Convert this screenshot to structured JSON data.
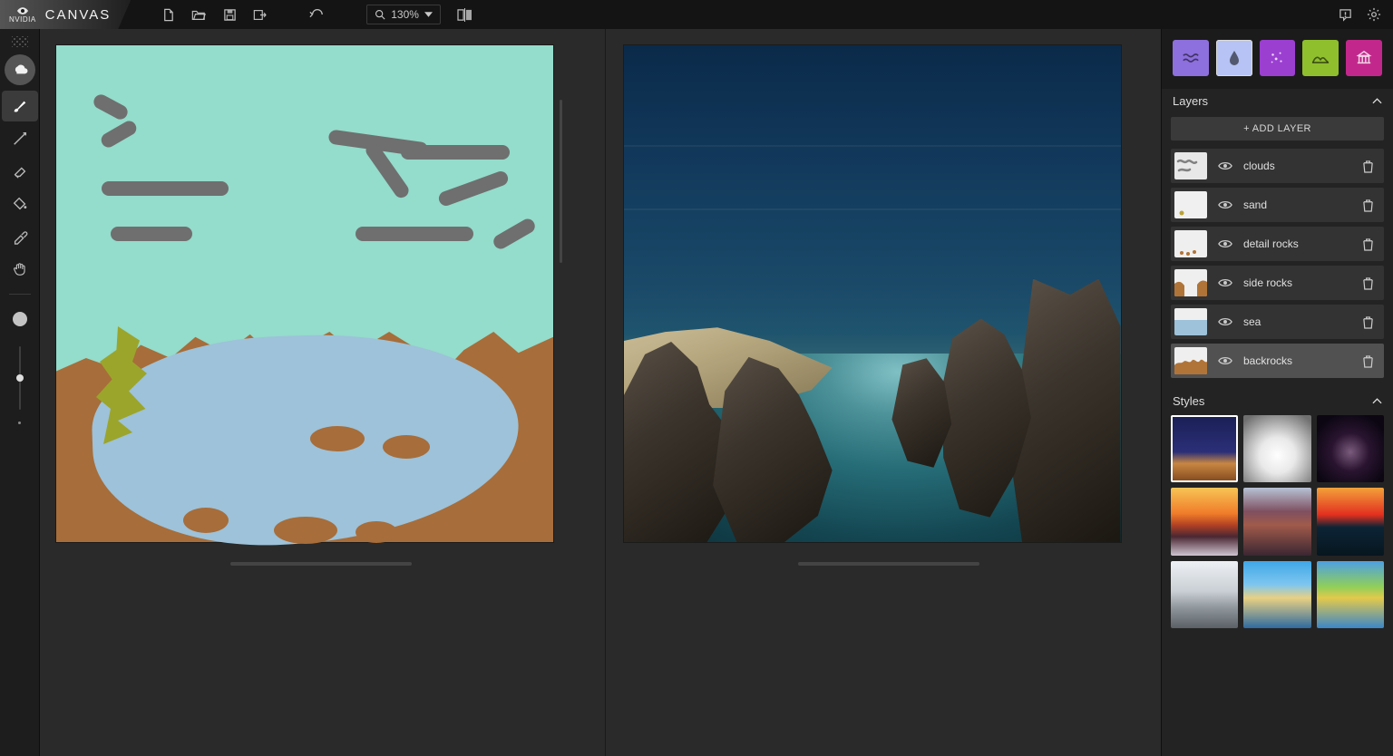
{
  "brand": {
    "vendor": "NVIDIA",
    "name": "CANVAS"
  },
  "toolbar": {
    "zoom_value": "130%",
    "icons": {
      "new": "new-file-icon",
      "open": "folder-open-icon",
      "save": "save-icon",
      "export": "export-icon",
      "undo": "undo-icon",
      "zoom_search": "search-icon",
      "zoom_caret": "caret-down-icon",
      "compare": "compare-split-icon",
      "feedback": "feedback-icon",
      "settings": "gear-icon"
    }
  },
  "left_tools": [
    {
      "id": "material",
      "icon": "cloud-icon",
      "active_round": true
    },
    {
      "id": "brush",
      "icon": "brush-icon",
      "active_row": false
    },
    {
      "id": "line",
      "icon": "pen-icon"
    },
    {
      "id": "eraser",
      "icon": "eraser-icon"
    },
    {
      "id": "fill",
      "icon": "bucket-icon"
    },
    {
      "id": "picker",
      "icon": "eyedropper-icon"
    },
    {
      "id": "pan",
      "icon": "hand-icon"
    }
  ],
  "brush": {
    "size_dot": true,
    "slider_pos": 0.5
  },
  "materials": [
    {
      "id": "water",
      "icon": "waves-icon",
      "color": "#8d6fdd"
    },
    {
      "id": "sky",
      "icon": "droplet-icon",
      "color": "#b6c3f4",
      "selected": true
    },
    {
      "id": "stars",
      "icon": "sparkle-icon",
      "color": "#9b3fd1"
    },
    {
      "id": "hill",
      "icon": "hill-icon",
      "color": "#8fbf2d"
    },
    {
      "id": "structure",
      "icon": "landmark-icon",
      "color": "#c2288b"
    }
  ],
  "layers": {
    "title": "Layers",
    "add_label": "+ ADD LAYER",
    "items": [
      {
        "name": "clouds",
        "thumb_bg": "#e8e8e8",
        "thumb_accent": "#808080",
        "shape": "scribble"
      },
      {
        "name": "sand",
        "thumb_bg": "#f0f0f0",
        "thumb_accent": "#b9a23a",
        "shape": "dot"
      },
      {
        "name": "detail rocks",
        "thumb_bg": "#efefef",
        "thumb_accent": "#b07438",
        "shape": "dots"
      },
      {
        "name": "side rocks",
        "thumb_bg": "#efefef",
        "thumb_accent": "#b07438",
        "shape": "corners"
      },
      {
        "name": "sea",
        "thumb_bg": "#9dc2d9",
        "thumb_accent": "#efefef",
        "shape": "half"
      },
      {
        "name": "backrocks",
        "thumb_bg": "#efefef",
        "thumb_accent": "#b07438",
        "shape": "wave",
        "selected": true
      }
    ]
  },
  "styles": {
    "title": "Styles",
    "items": [
      {
        "id": "s1",
        "selected": true,
        "bg": "linear-gradient(180deg,#1a1f55 0%,#2b2f78 55%,#c88742 72%,#80471c 100%)"
      },
      {
        "id": "s2",
        "bg": "radial-gradient(circle at 50% 60%, #fefefe 0%, #e9e9e9 34%, #bdbdbd 55%, #6f6f6f 90%)"
      },
      {
        "id": "s3",
        "bg": "radial-gradient(circle at 50% 55%, #7a5b7d 0%, #2a1430 38%, #0b0612 80%)"
      },
      {
        "id": "s4",
        "bg": "linear-gradient(180deg,#f7c456 0%,#f07c2a 38%,#b24124 55%,#4a2733 72%,#cfc5d2 100%)"
      },
      {
        "id": "s5",
        "bg": "linear-gradient(180deg,#b7c2d6 0%,#7e5060 35%,#a05a4a 55%,#3a2732 100%)"
      },
      {
        "id": "s6",
        "bg": "linear-gradient(180deg,#f3a13a 0%,#e32f1f 40%,#0c2436 58%,#07161f 100%)"
      },
      {
        "id": "s7",
        "bg": "linear-gradient(180deg,#eef1f4 0%,#c9cfd4 45%,#8e959b 70%,#5a6066 100%)"
      },
      {
        "id": "s8",
        "bg": "linear-gradient(180deg,#3fa7e6 0%,#7ec6ef 35%,#e9d083 55%,#2f6aa0 100%)"
      },
      {
        "id": "s9",
        "bg": "linear-gradient(180deg,#4d9fe3 0%,#8fcf5a 38%,#e3c94c 55%,#3b86c9 100%)"
      }
    ]
  }
}
